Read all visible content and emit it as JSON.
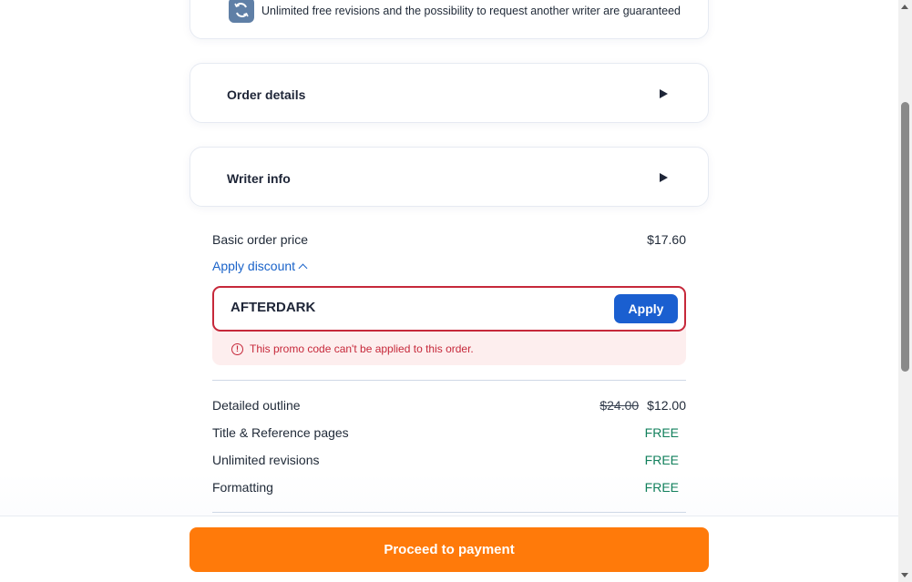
{
  "guarantee": {
    "text": "Unlimited free revisions and the possibility to request another writer are guaranteed",
    "icon": "refresh-icon"
  },
  "accordions": [
    {
      "title": "Order details"
    },
    {
      "title": "Writer info"
    }
  ],
  "pricing": {
    "basic_label": "Basic order price",
    "basic_value": "$17.60",
    "discount_toggle": "Apply discount"
  },
  "promo": {
    "code": "AFTERDARK",
    "apply_label": "Apply",
    "error": "This promo code can't be applied to this order.",
    "error_icon": "!"
  },
  "extras": [
    {
      "label": "Detailed outline",
      "old_price": "$24.00",
      "price": "$12.00"
    },
    {
      "label": "Title & Reference pages",
      "price": "FREE"
    },
    {
      "label": "Unlimited revisions",
      "price": "FREE"
    },
    {
      "label": "Formatting",
      "price": "FREE"
    }
  ],
  "footer": {
    "cta": "Proceed to payment"
  },
  "colors": {
    "cta": "#ff7a0a",
    "apply": "#1a5fd0",
    "error": "#c6283a",
    "link": "#1a63c9",
    "free": "#12805c"
  }
}
